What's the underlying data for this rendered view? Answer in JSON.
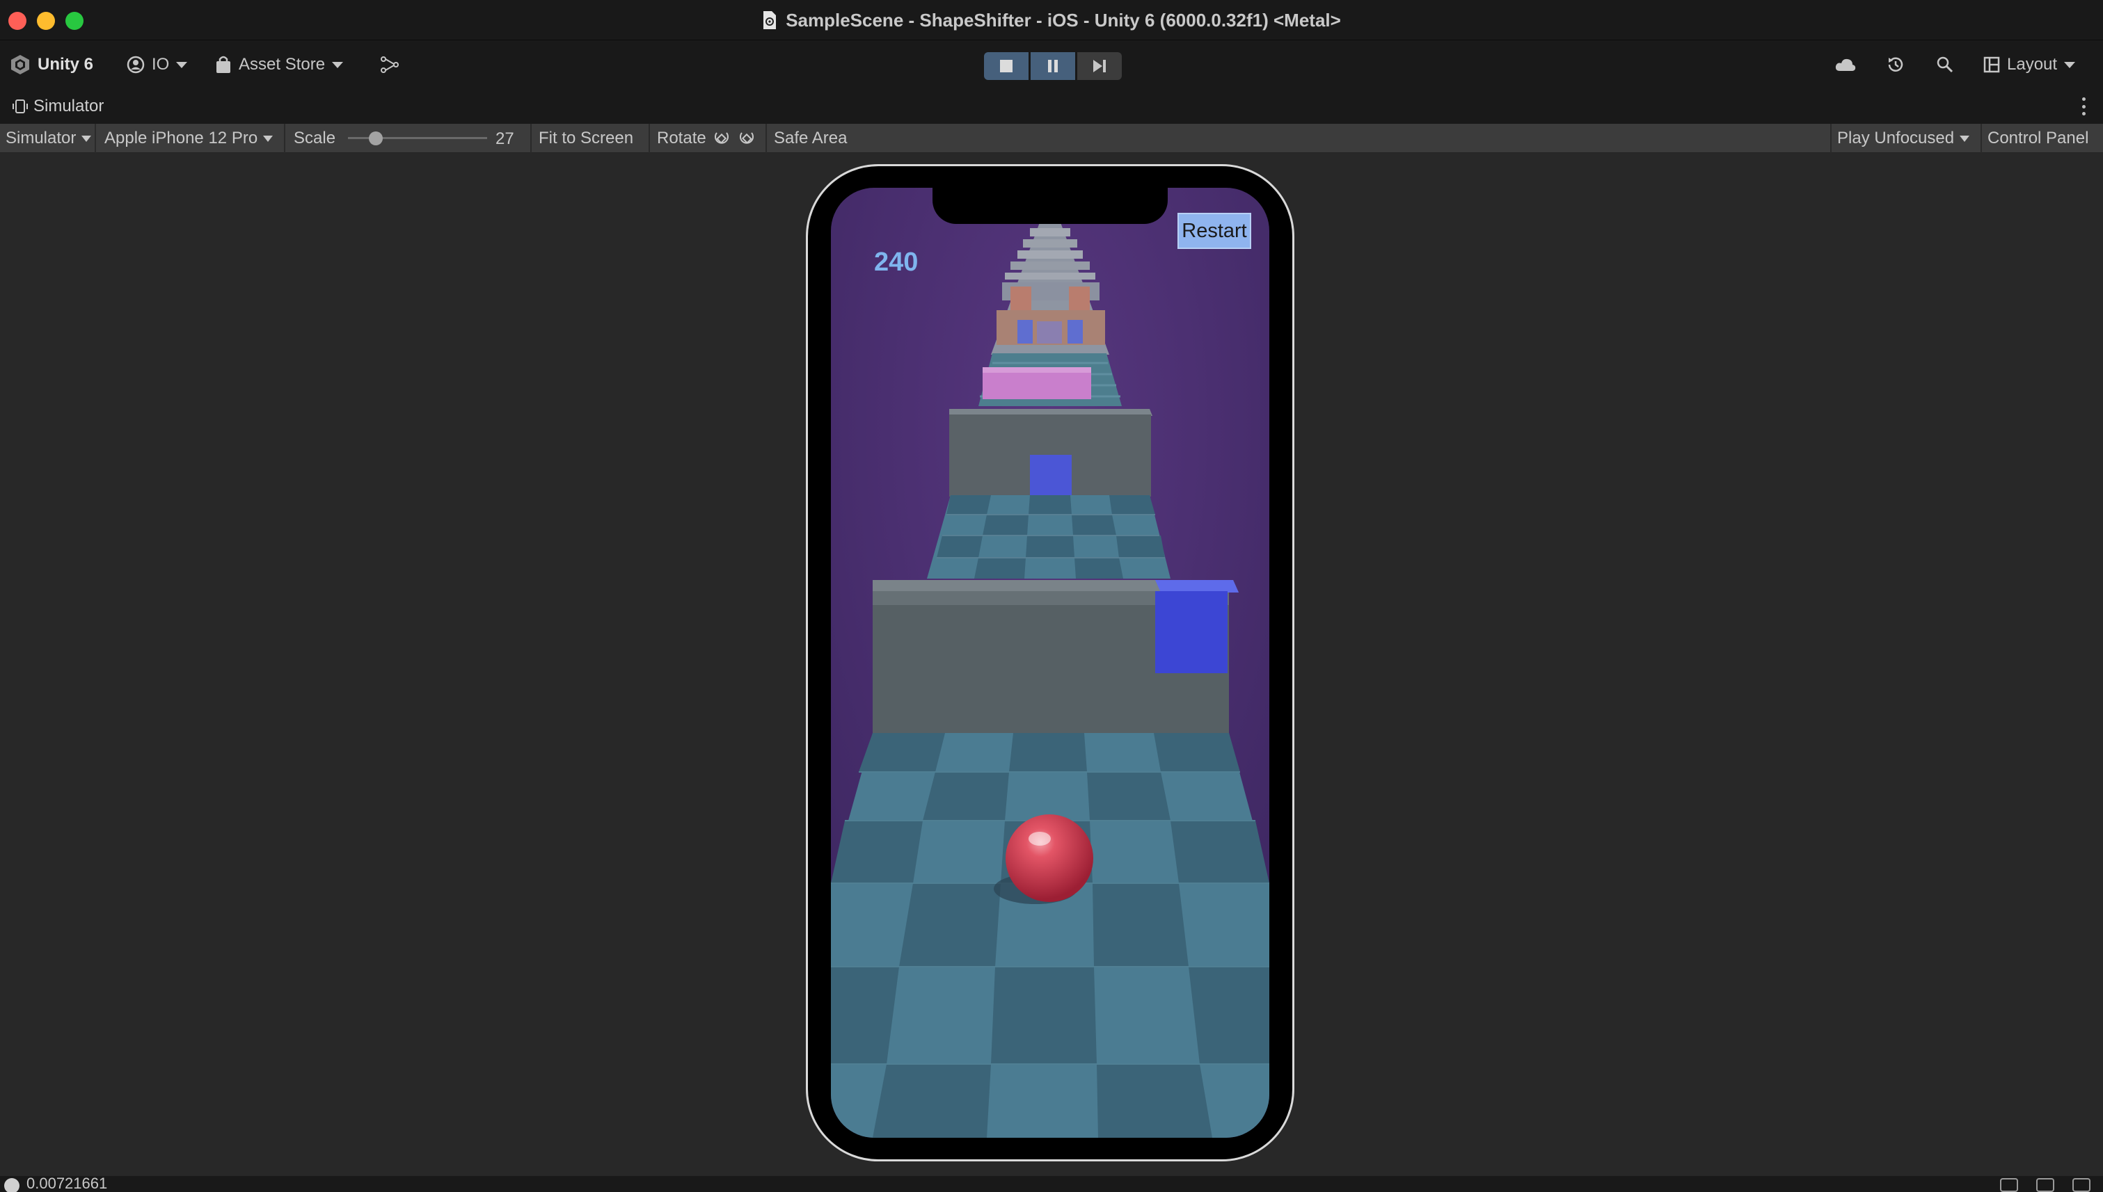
{
  "window": {
    "title": "SampleScene - ShapeShifter - iOS - Unity 6 (6000.0.32f1) <Metal>"
  },
  "toolbar": {
    "unity_label": "Unity 6",
    "account_label": "IO",
    "asset_store_label": "Asset Store",
    "layout_label": "Layout",
    "icons": [
      "unity-logo-icon",
      "account-icon",
      "asset-store-icon",
      "version-control-icon",
      "stop-icon",
      "pause-icon",
      "step-icon",
      "cloud-icon",
      "history-icon",
      "search-icon",
      "layout-icon"
    ],
    "play_active_color": "#46607c"
  },
  "panel": {
    "tab_label": "Simulator"
  },
  "simulator_toolbar": {
    "view_mode": "Simulator",
    "device": "Apple iPhone 12 Pro",
    "scale_label": "Scale",
    "scale_value": "27",
    "fit_to_screen": "Fit to Screen",
    "rotate_label": "Rotate",
    "safe_area": "Safe Area",
    "play_mode": "Play Unfocused",
    "control_panel": "Control Panel"
  },
  "game": {
    "score": "240",
    "restart_label": "Restart",
    "colors": {
      "sky": "#4a2f72",
      "floor_light": "#4b7c92",
      "floor_dark": "#3b6478",
      "wall": "#555d63",
      "blue_block": "#3c46d4",
      "pink_block": "#c97fcc",
      "ball": "#d64456",
      "restart_bg": "#8fb4ee",
      "score_text": "#7fb5ee"
    }
  },
  "status": {
    "text": "0.00721661"
  }
}
